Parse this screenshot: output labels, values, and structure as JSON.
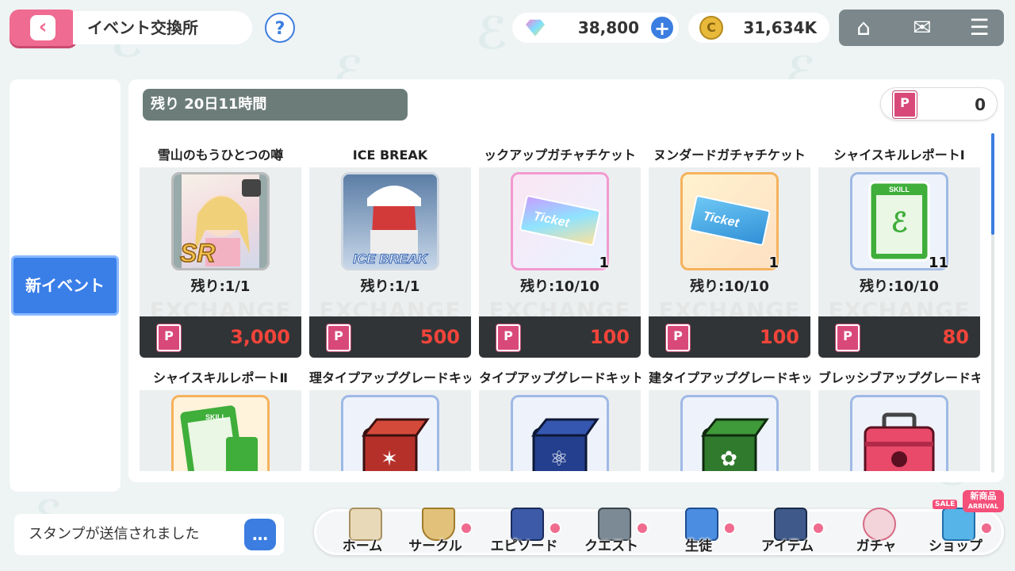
{
  "header": {
    "title": "イベント交換所",
    "gems": "38,800",
    "coins": "31,634K"
  },
  "sidebar": {
    "tab_new_event": "新イベント"
  },
  "shop": {
    "remaining_time": "残り 20日11時間",
    "points": "0",
    "watermark": "EXCHANGE",
    "items": [
      {
        "name": "雪山のもうひとつの噂",
        "qty": "",
        "remaining": "残り:1/1",
        "price": "3,000",
        "badge": "SR"
      },
      {
        "name": "ICE BREAK",
        "qty": "",
        "remaining": "残り:1/1",
        "price": "500",
        "badge": "ICE BREAK"
      },
      {
        "name": "ックアップガチャチケット",
        "qty": "1",
        "remaining": "残り:10/10",
        "price": "100",
        "badge": "Ticket"
      },
      {
        "name": "ヌンダードガチャチケット",
        "qty": "1",
        "remaining": "残り:10/10",
        "price": "100",
        "badge": "Ticket"
      },
      {
        "name": "シャイスキルレポートⅠ",
        "qty": "11",
        "remaining": "残り:10/10",
        "price": "80",
        "badge": "SKILL"
      },
      {
        "name": "シャイスキルレポートⅡ",
        "qty": "",
        "remaining": "",
        "price": "",
        "badge": "SKILL"
      },
      {
        "name": "理タイプアップグレードキッ",
        "qty": "",
        "remaining": "",
        "price": "",
        "badge": ""
      },
      {
        "name": "タイプアップグレードキット",
        "qty": "",
        "remaining": "",
        "price": "",
        "badge": ""
      },
      {
        "name": "建タイプアップグレードキッ",
        "qty": "",
        "remaining": "",
        "price": "",
        "badge": ""
      },
      {
        "name": "ブレッシブアップグレードキ",
        "qty": "",
        "remaining": "",
        "price": "",
        "badge": ""
      }
    ]
  },
  "footer": {
    "stamp_message": "スタンプが送信されました",
    "nav": [
      "ホーム",
      "サークル",
      "エピソード",
      "クエスト",
      "生徒",
      "アイテム",
      "ガチャ",
      "ショップ"
    ],
    "sale_badge": "SALE",
    "new_badge": "新商品",
    "arrival_badge": "ARRIVAL"
  },
  "colors": {
    "accent": "#3b7de0",
    "back": "#f06b92",
    "price": "#f2443a",
    "point": "#d8497a"
  }
}
